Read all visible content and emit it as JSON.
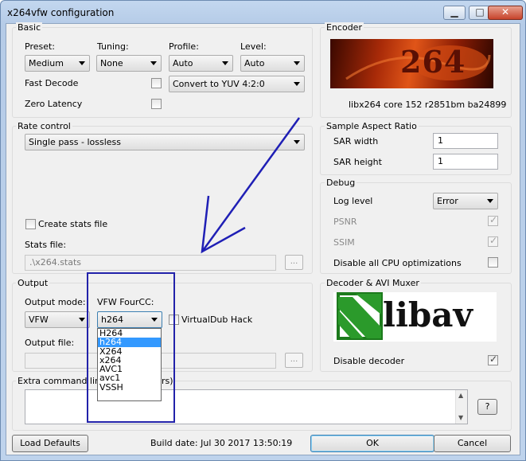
{
  "window": {
    "title": "x264vfw configuration",
    "minimize": "▁",
    "maximize": "□",
    "close": "✕"
  },
  "basic": {
    "title": "Basic",
    "preset": {
      "label": "Preset:",
      "value": "Medium"
    },
    "tuning": {
      "label": "Tuning:",
      "value": "None"
    },
    "profile": {
      "label": "Profile:",
      "value": "Auto"
    },
    "level": {
      "label": "Level:",
      "value": "Auto"
    },
    "fast_decode": {
      "label": "Fast Decode",
      "checked": false
    },
    "zero_latency": {
      "label": "Zero Latency",
      "checked": false
    },
    "colorspace": "Convert to YUV 4:2:0"
  },
  "encoder": {
    "title": "Encoder",
    "logo_text": "264",
    "version": "libx264 core 152 r2851bm ba24899"
  },
  "rate_control": {
    "title": "Rate control",
    "mode": "Single pass - lossless",
    "create_stats": {
      "label": "Create stats file",
      "checked": false
    },
    "stats_file_label": "Stats file:",
    "stats_file_value": ".\\x264.stats",
    "browse": "..."
  },
  "sar": {
    "title": "Sample Aspect Ratio",
    "width_label": "SAR width",
    "width_value": "1",
    "height_label": "SAR height",
    "height_value": "1"
  },
  "debug": {
    "title": "Debug",
    "log_level_label": "Log level",
    "log_level_value": "Error",
    "psnr": {
      "label": "PSNR",
      "checked": true
    },
    "ssim": {
      "label": "SSIM",
      "checked": true
    },
    "disable_cpu": {
      "label": "Disable all CPU optimizations",
      "checked": false
    }
  },
  "output": {
    "title": "Output",
    "mode_label": "Output mode:",
    "mode_value": "VFW",
    "fourcc_label": "VFW FourCC:",
    "fourcc_value": "h264",
    "virtualdub": {
      "label": "VirtualDub Hack",
      "checked": false
    },
    "file_label": "Output file:",
    "browse": "...",
    "fourcc_options": [
      "H264",
      "h264",
      "X264",
      "x264",
      "AVC1",
      "avc1",
      "VSSH"
    ],
    "fourcc_selected_index": 1
  },
  "decoder": {
    "title": "Decoder & AVI Muxer",
    "logo_text": "libav",
    "disable_decoder": {
      "label": "Disable decoder",
      "checked": true
    }
  },
  "extra": {
    "title_left": "Extra command line (t",
    "title_right": "rs)",
    "help": "?"
  },
  "footer": {
    "load_defaults": "Load Defaults",
    "build_date": "Build date: Jul 30 2017 13:50:19",
    "ok": "OK",
    "cancel": "Cancel"
  },
  "colors": {
    "annotation": "#2222aa",
    "selection": "#3399ff"
  }
}
